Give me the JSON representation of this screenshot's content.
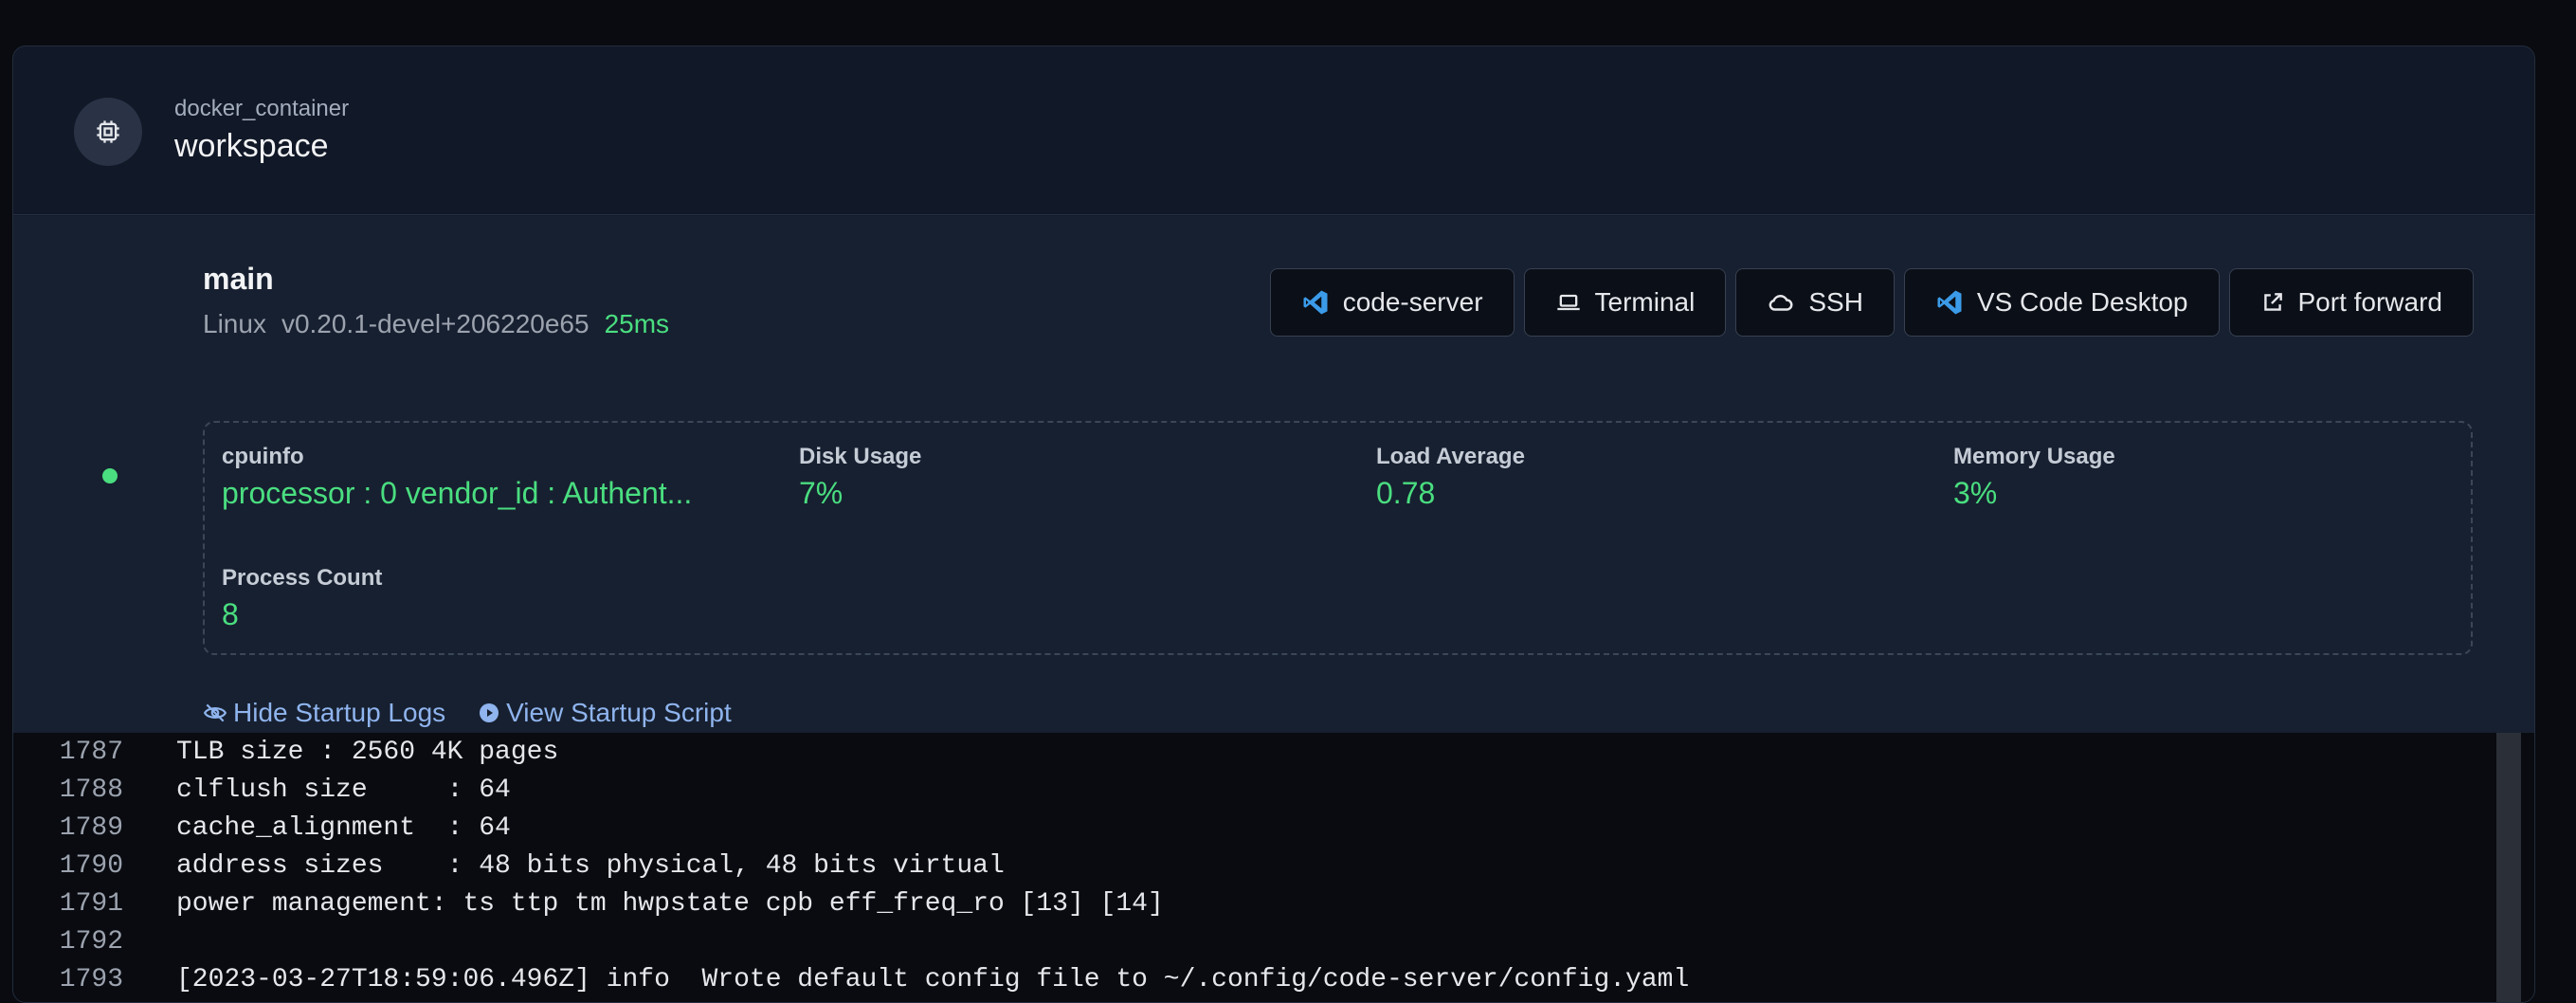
{
  "resource": {
    "kind": "docker_container",
    "name": "workspace",
    "icon": "cpu-chip-icon"
  },
  "agent": {
    "name": "main",
    "os": "Linux",
    "version": "v0.20.1-devel+206220e65",
    "latency": "25ms",
    "status_color": "#4ade80",
    "buttons": [
      {
        "label": "code-server",
        "icon": "vscode-icon"
      },
      {
        "label": "Terminal",
        "icon": "laptop-icon"
      },
      {
        "label": "SSH",
        "icon": "cloud-icon"
      },
      {
        "label": "VS Code Desktop",
        "icon": "vscode-icon"
      },
      {
        "label": "Port forward",
        "icon": "external-link-icon"
      }
    ],
    "stats": [
      {
        "label": "cpuinfo",
        "value": "processor : 0 vendor_id : Authent..."
      },
      {
        "label": "Disk Usage",
        "value": "7%"
      },
      {
        "label": "Load Average",
        "value": "0.78"
      },
      {
        "label": "Memory Usage",
        "value": "3%"
      },
      {
        "label": "Process Count",
        "value": "8"
      }
    ],
    "links": {
      "hide_logs": "Hide Startup Logs",
      "view_script": "View Startup Script"
    }
  },
  "logs": [
    {
      "num": "1787",
      "text": "TLB size : 2560 4K pages"
    },
    {
      "num": "1788",
      "text": "clflush size     : 64"
    },
    {
      "num": "1789",
      "text": "cache_alignment  : 64"
    },
    {
      "num": "1790",
      "text": "address sizes    : 48 bits physical, 48 bits virtual"
    },
    {
      "num": "1791",
      "text": "power management: ts ttp tm hwpstate cpb eff_freq_ro [13] [14]"
    },
    {
      "num": "1792",
      "text": ""
    },
    {
      "num": "1793",
      "text": "[2023-03-27T18:59:06.496Z] info  Wrote default config file to ~/.config/code-server/config.yaml"
    }
  ]
}
